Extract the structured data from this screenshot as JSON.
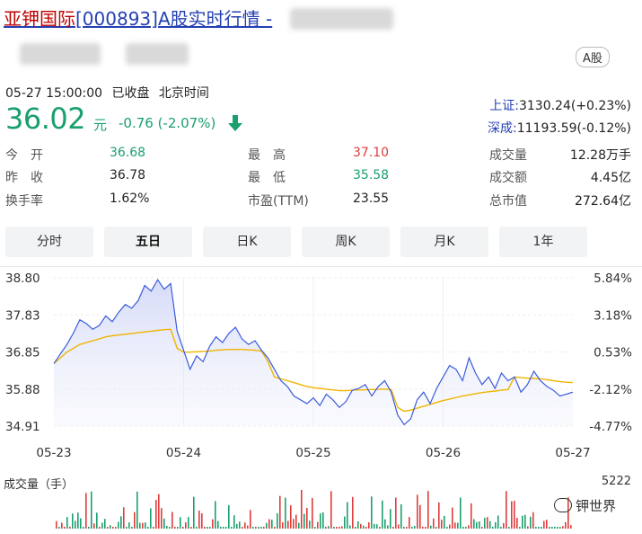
{
  "header": {
    "title_highlight": "亚钾国际",
    "title_rest": "[000893]A股实时行情 -",
    "badge": "A股"
  },
  "status": {
    "datetime": "05-27 15:00:00",
    "state": "已收盘",
    "timezone": "北京时间"
  },
  "quote": {
    "price": "36.02",
    "unit": "元",
    "change": "-0.76 (-2.07%)",
    "direction": "down"
  },
  "indices": [
    {
      "name": "上证:",
      "value": "3130.24(+0.23%)"
    },
    {
      "name": "深成:",
      "value": "11193.59(-0.12%)"
    }
  ],
  "stats": {
    "col1": [
      {
        "label": "今　开",
        "value": "36.68",
        "color": "#1aa06d"
      },
      {
        "label": "昨　收",
        "value": "36.78",
        "color": "#222222"
      },
      {
        "label": "换手率",
        "value": "1.62%",
        "color": "#222222"
      }
    ],
    "col2": [
      {
        "label": "最　高",
        "value": "37.10",
        "color": "#e03c3c"
      },
      {
        "label": "最　低",
        "value": "35.58",
        "color": "#1aa06d"
      },
      {
        "label": "市盈(TTM)",
        "value": "23.55",
        "color": "#222222"
      }
    ],
    "col3": [
      {
        "label": "成交量",
        "value": "12.28万手",
        "color": "#222222"
      },
      {
        "label": "成交额",
        "value": "4.45亿",
        "color": "#222222"
      },
      {
        "label": "总市值",
        "value": "272.64亿",
        "color": "#222222"
      }
    ]
  },
  "tabs": [
    "分时",
    "五日",
    "日K",
    "周K",
    "月K",
    "1年"
  ],
  "active_tab": "五日",
  "volume": {
    "label": "成交量（手）",
    "max": "5222"
  },
  "watermark": "钾世界",
  "colors": {
    "up": "#e03c3c",
    "down": "#1aa06d",
    "price_line": "#3b5bdb",
    "avg_line": "#f0b400"
  },
  "chart_data": {
    "type": "line",
    "title": "",
    "x": [
      "05-23",
      "05-24",
      "05-25",
      "05-26",
      "05-27"
    ],
    "y_ticks_left": [
      "38.80",
      "37.83",
      "36.85",
      "35.88",
      "34.91"
    ],
    "y_ticks_right": [
      "5.84%",
      "3.18%",
      "0.53%",
      "-2.12%",
      "-4.77%"
    ],
    "ylim": [
      34.91,
      38.8
    ],
    "series": [
      {
        "values": [
          36.55,
          36.8,
          37.05,
          37.35,
          37.7,
          37.6,
          37.45,
          37.55,
          37.8,
          37.65,
          37.9,
          38.1,
          38.0,
          38.2,
          38.6,
          38.45,
          38.75,
          38.5,
          38.65,
          37.4,
          36.9,
          36.4,
          36.75,
          36.6,
          37.0,
          37.25,
          37.1,
          37.35,
          37.5,
          37.2,
          37.05,
          37.15,
          36.9,
          36.7,
          36.4,
          36.1,
          35.95,
          35.7,
          35.6,
          35.5,
          35.65,
          35.45,
          35.75,
          35.6,
          35.4,
          35.55,
          35.85,
          35.9,
          36.0,
          35.7,
          35.95,
          36.1,
          35.8,
          35.2,
          34.95,
          35.1,
          35.6,
          35.8,
          35.5,
          35.9,
          36.2,
          36.5,
          36.4,
          36.1,
          36.7,
          36.3,
          36.0,
          36.2,
          35.9,
          36.3,
          36.1,
          36.2,
          35.8,
          36.0,
          36.35,
          36.1,
          35.95,
          35.85,
          35.7,
          35.75,
          35.8
        ],
        "color": "#3b5bdb"
      },
      {
        "values": [
          36.55,
          36.7,
          36.85,
          36.95,
          37.05,
          37.1,
          37.15,
          37.2,
          37.25,
          37.28,
          37.3,
          37.32,
          37.34,
          37.36,
          37.38,
          37.4,
          37.42,
          37.44,
          37.45,
          36.95,
          36.85,
          36.85,
          36.86,
          36.87,
          36.88,
          36.9,
          36.91,
          36.92,
          36.92,
          36.92,
          36.91,
          36.9,
          36.88,
          36.6,
          36.2,
          36.15,
          36.1,
          36.05,
          36.0,
          35.95,
          35.92,
          35.9,
          35.88,
          35.86,
          35.84,
          35.84,
          35.85,
          35.86,
          35.86,
          35.87,
          35.88,
          35.88,
          35.87,
          35.4,
          35.3,
          35.33,
          35.38,
          35.43,
          35.48,
          35.53,
          35.58,
          35.62,
          35.66,
          35.7,
          35.73,
          35.76,
          35.79,
          35.81,
          35.83,
          35.85,
          35.87,
          36.2,
          36.18,
          36.17,
          36.16,
          36.15,
          36.13,
          36.1,
          36.08,
          36.06,
          36.05
        ],
        "color": "#f0b400"
      }
    ]
  }
}
